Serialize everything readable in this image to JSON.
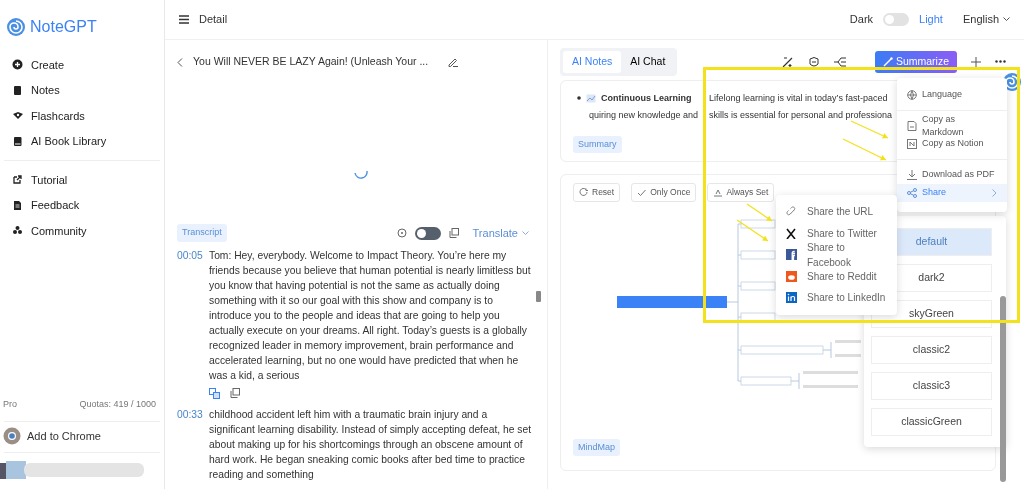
{
  "app": {
    "name": "NoteGPT"
  },
  "sidebar": {
    "groups": [
      [
        {
          "label": "Create"
        },
        {
          "label": "Notes"
        },
        {
          "label": "Flashcards"
        },
        {
          "label": "AI Book Library"
        }
      ],
      [
        {
          "label": "Tutorial"
        },
        {
          "label": "Feedback"
        },
        {
          "label": "Community"
        }
      ]
    ],
    "plan": "Pro",
    "quota": "Quotas: 419 / 1000",
    "extension": "Add to Chrome"
  },
  "header": {
    "title": "Detail",
    "theme": {
      "dark_label": "Dark",
      "light_label": "Light",
      "dark_on": false
    },
    "language": "English"
  },
  "video": {
    "title": "You Will NEVER BE LAZY Again! (Unleash Your ...",
    "loading": true
  },
  "transcript": {
    "tag": "Transcript",
    "toggle_on": false,
    "translate": "Translate",
    "entries": [
      {
        "time": "00:05",
        "text": "Tom: Hey, everybody. Welcome to Impact Theory. You’re here my friends because you believe that human potential is nearly limitless but you know that having potential is not the same as actually doing something with it so our goal with this show and company is to introduce you to the people and ideas that are going to help you actually execute on your dreams. All right. Today’s guests is a globally recognized leader in memory improvement, brain performance and accelerated learning, but no one would have predicted that when he was a kid, a serious"
      },
      {
        "time": "00:33",
        "text": "childhood accident left him with a traumatic brain injury and a significant learning disability. Instead of simply accepting defeat, he set about making up for his shortcomings through an obscene amount of hard work. He began sneaking comic books after bed time to practice reading and something"
      }
    ]
  },
  "notes": {
    "tabs": [
      {
        "label": "AI Notes",
        "selected": true
      },
      {
        "label": "AI Chat",
        "selected": false
      }
    ],
    "summarize": "Summarize",
    "bullet_lines": [
      [
        "**Continuous Learning**",
        "Lifelong learning is vital in today’s fast-paced"
      ],
      [
        "quiring new knowledge and",
        "skills is essential for personal and professiona"
      ]
    ],
    "tag": "Summary"
  },
  "mindmap": {
    "buttons": [
      "Reset",
      "Only Once",
      "Always Set"
    ],
    "tag": "MindMap",
    "themes": [
      {
        "label": "default",
        "selected": true
      },
      {
        "label": "dark2",
        "selected": false
      },
      {
        "label": "skyGreen",
        "selected": false
      },
      {
        "label": "classic2",
        "selected": false
      },
      {
        "label": "classic3",
        "selected": false
      },
      {
        "label": "classicGreen",
        "selected": false
      }
    ]
  },
  "menu": {
    "groups": [
      [
        {
          "label": "Language",
          "kind": "item",
          "selected": false
        }
      ],
      [
        {
          "label": "Copy as Markdown",
          "kind": "item",
          "selected": false
        },
        {
          "label": "Copy as Notion",
          "kind": "item",
          "selected": false
        }
      ],
      [
        {
          "label": "Download as PDF",
          "kind": "item",
          "selected": false
        },
        {
          "label": "Share",
          "kind": "submenu",
          "selected": true
        }
      ]
    ]
  },
  "share_menu": {
    "items": [
      "Share the URL",
      "Share to Twitter",
      "Share to Facebook",
      "Share to Reddit",
      "Share to LinkedIn"
    ]
  }
}
